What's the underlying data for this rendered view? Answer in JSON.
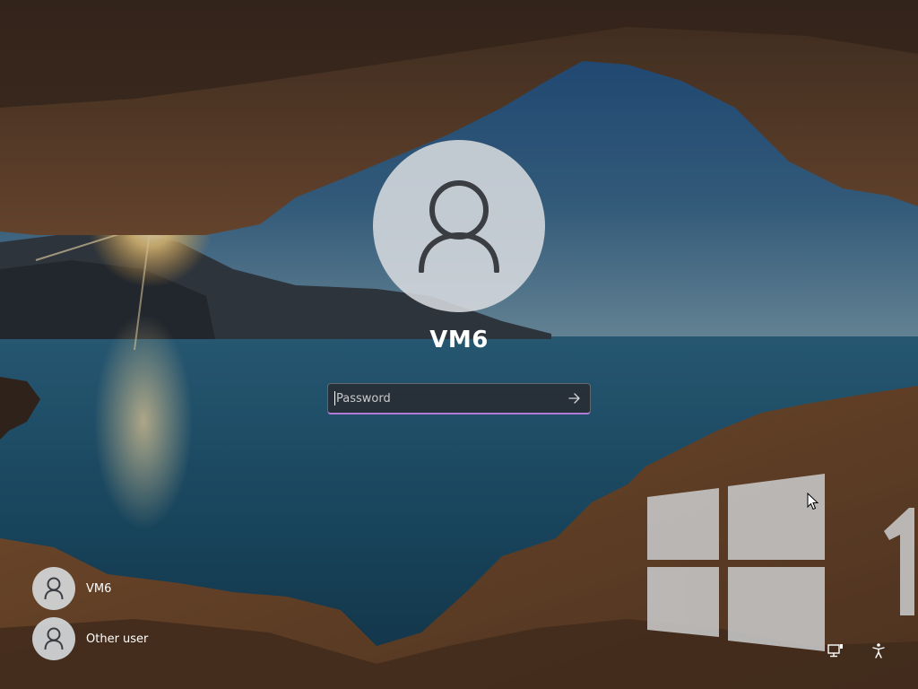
{
  "login": {
    "username": "VM6",
    "password_placeholder": "Password"
  },
  "user_list": [
    {
      "label": "VM6"
    },
    {
      "label": "Other user"
    }
  ],
  "icons": {
    "avatar": "person-icon",
    "submit": "arrow-right-icon",
    "network": "network-icon",
    "accessibility": "accessibility-icon",
    "logo": "windows-logo"
  },
  "colors": {
    "focus_underline": "#b07ad9",
    "avatar_bg": "#d6dade",
    "text": "#ffffff"
  }
}
